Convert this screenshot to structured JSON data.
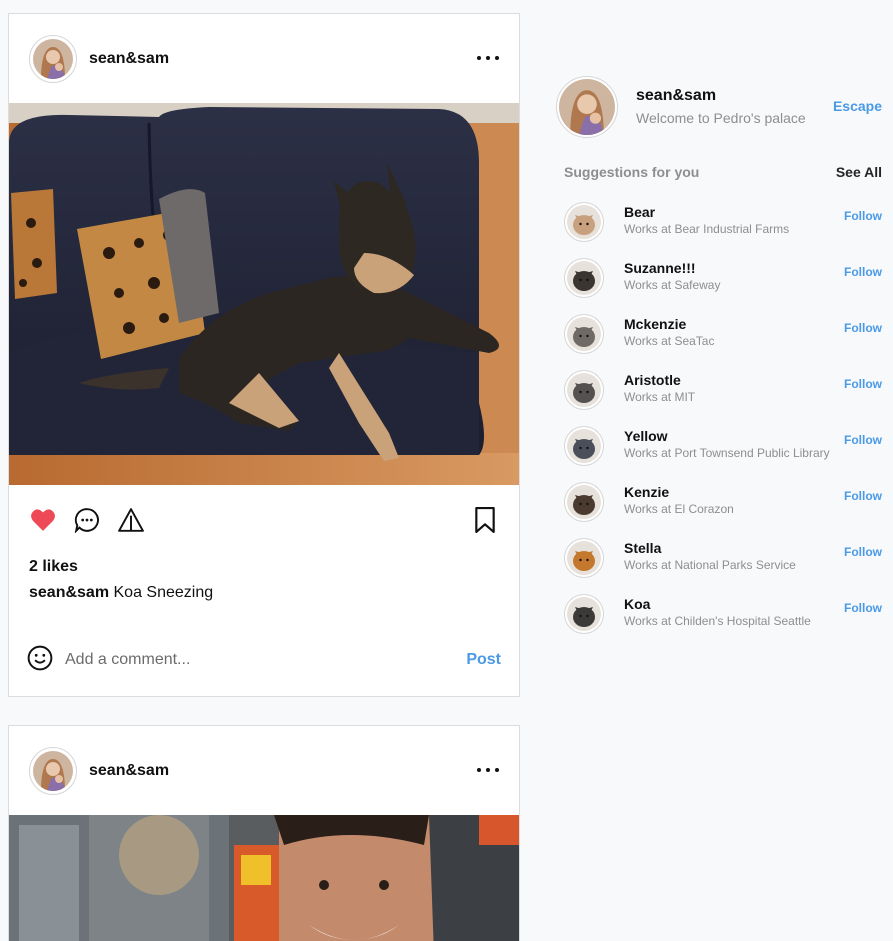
{
  "posts": [
    {
      "username": "sean&sam",
      "likes": "2 likes",
      "caption_user": "sean&sam",
      "caption_text": " Koa Sneezing",
      "comment_placeholder": "Add a comment...",
      "post_label": "Post"
    },
    {
      "username": "sean&sam"
    }
  ],
  "profile": {
    "username": "sean&sam",
    "subtitle": "Welcome to Pedro's palace",
    "escape_label": "Escape"
  },
  "suggestions": {
    "title": "Suggestions for you",
    "see_all_label": "See All",
    "follow_label": "Follow",
    "items": [
      {
        "name": "Bear",
        "subtitle": "Works at Bear Industrial Farms",
        "color": "#c9a07e"
      },
      {
        "name": "Suzanne!!!",
        "subtitle": "Works at Safeway",
        "color": "#3a3530"
      },
      {
        "name": "Mckenzie",
        "subtitle": "Works at SeaTac",
        "color": "#6f6a64"
      },
      {
        "name": "Aristotle",
        "subtitle": "Works at MIT",
        "color": "#555150"
      },
      {
        "name": "Yellow",
        "subtitle": "Works at Port Townsend Public Library",
        "color": "#4a4f5a"
      },
      {
        "name": "Kenzie",
        "subtitle": "Works at El Corazon",
        "color": "#4b3a30"
      },
      {
        "name": "Stella",
        "subtitle": "Works at National Parks Service",
        "color": "#c4782e"
      },
      {
        "name": "Koa",
        "subtitle": "Works at Childen's Hospital Seattle",
        "color": "#3c3a38"
      }
    ]
  },
  "icons": [
    "more-icon",
    "heart-icon",
    "comment-icon",
    "share-icon",
    "bookmark-icon",
    "smiley-icon"
  ],
  "colors": {
    "accent": "#4a9ae6",
    "like": "#ed4956",
    "muted": "#8e8e8e"
  }
}
